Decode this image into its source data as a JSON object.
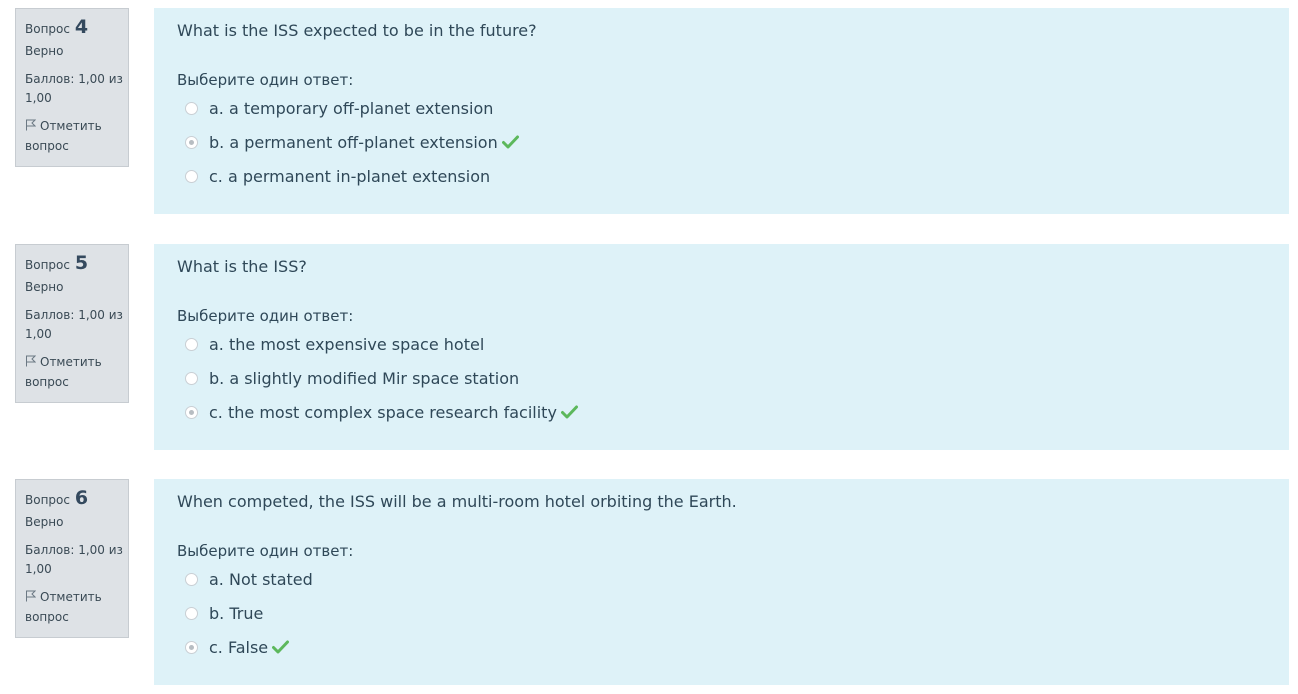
{
  "labels": {
    "question": "Вопрос",
    "flag": "Отметить вопрос",
    "prompt": "Выберите один ответ:"
  },
  "colors": {
    "content_bg": "#def2f8",
    "info_bg": "#dee2e6",
    "correct_check": "#5cb85c"
  },
  "questions": [
    {
      "number": "4",
      "state": "Верно",
      "grade": "Баллов: 1,00 из 1,00",
      "text": "What is the ISS expected to be in the future?",
      "answers": [
        {
          "label": "a. a temporary off-planet extension",
          "selected": false,
          "correct": false
        },
        {
          "label": "b. a permanent off-planet extension",
          "selected": true,
          "correct": true
        },
        {
          "label": "c. a permanent in-planet extension",
          "selected": false,
          "correct": false
        }
      ]
    },
    {
      "number": "5",
      "state": "Верно",
      "grade": "Баллов: 1,00 из 1,00",
      "text": "What is the ISS?",
      "answers": [
        {
          "label": "a. the most expensive space hotel",
          "selected": false,
          "correct": false
        },
        {
          "label": "b. a slightly modified Mir space station",
          "selected": false,
          "correct": false
        },
        {
          "label": "c. the most complex space research facility",
          "selected": true,
          "correct": true
        }
      ]
    },
    {
      "number": "6",
      "state": "Верно",
      "grade": "Баллов: 1,00 из 1,00",
      "text": "When competed, the ISS will be a multi-room hotel orbiting the Earth.",
      "answers": [
        {
          "label": "a. Not stated",
          "selected": false,
          "correct": false
        },
        {
          "label": "b. True",
          "selected": false,
          "correct": false
        },
        {
          "label": "c. False",
          "selected": true,
          "correct": true
        }
      ]
    }
  ]
}
